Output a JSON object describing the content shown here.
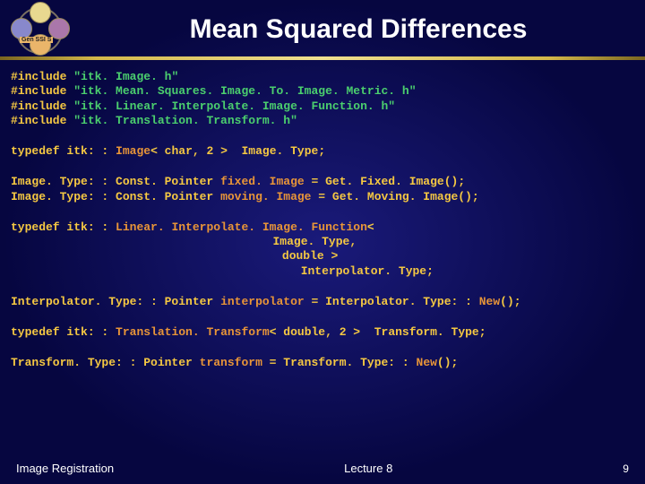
{
  "header": {
    "logo_label": "Gen SSI S",
    "title": "Mean Squared Differences"
  },
  "code": {
    "inc_kw": "#include",
    "inc1": "\"itk. Image. h\"",
    "inc2": "\"itk. Mean. Squares. Image. To. Image. Metric. h\"",
    "inc3": "\"itk. Linear. Interpolate. Image. Function. h\"",
    "inc4": "\"itk. Translation. Transform. h\"",
    "td_kw": "typedef",
    "itk_ns": "itk: :",
    "image_cls": "Image",
    "image_args": "< char, 2 >",
    "image_type": "Image. Type;",
    "cp_prefix": "Image. Type: : Const. Pointer",
    "fixed_name": "fixed. Image",
    "fixed_rest": "  = Get. Fixed. Image();",
    "moving_name": "moving. Image",
    "moving_rest": " = Get. Moving. Image();",
    "lin_cls": "Linear. Interpolate. Image. Function",
    "lt": "<",
    "interp_arg1": "Image. Type,",
    "interp_arg2": "double >",
    "interp_name": "Interpolator. Type;",
    "interp_ptr": "Interpolator. Type: : Pointer",
    "interp_var": "interpolator",
    "interp_eq": " = Interpolator. Type: :",
    "new_call": "New",
    "paren_semi": "();",
    "trans_cls": "Translation. Transform",
    "trans_args": "< double, 2 >",
    "trans_type": "Transform. Type;",
    "trans_ptr": "Transform. Type: : Pointer",
    "trans_var": "transform",
    "trans_eq": " = Transform. Type: :"
  },
  "footer": {
    "left": "Image Registration",
    "center": "Lecture 8",
    "page": "9"
  }
}
